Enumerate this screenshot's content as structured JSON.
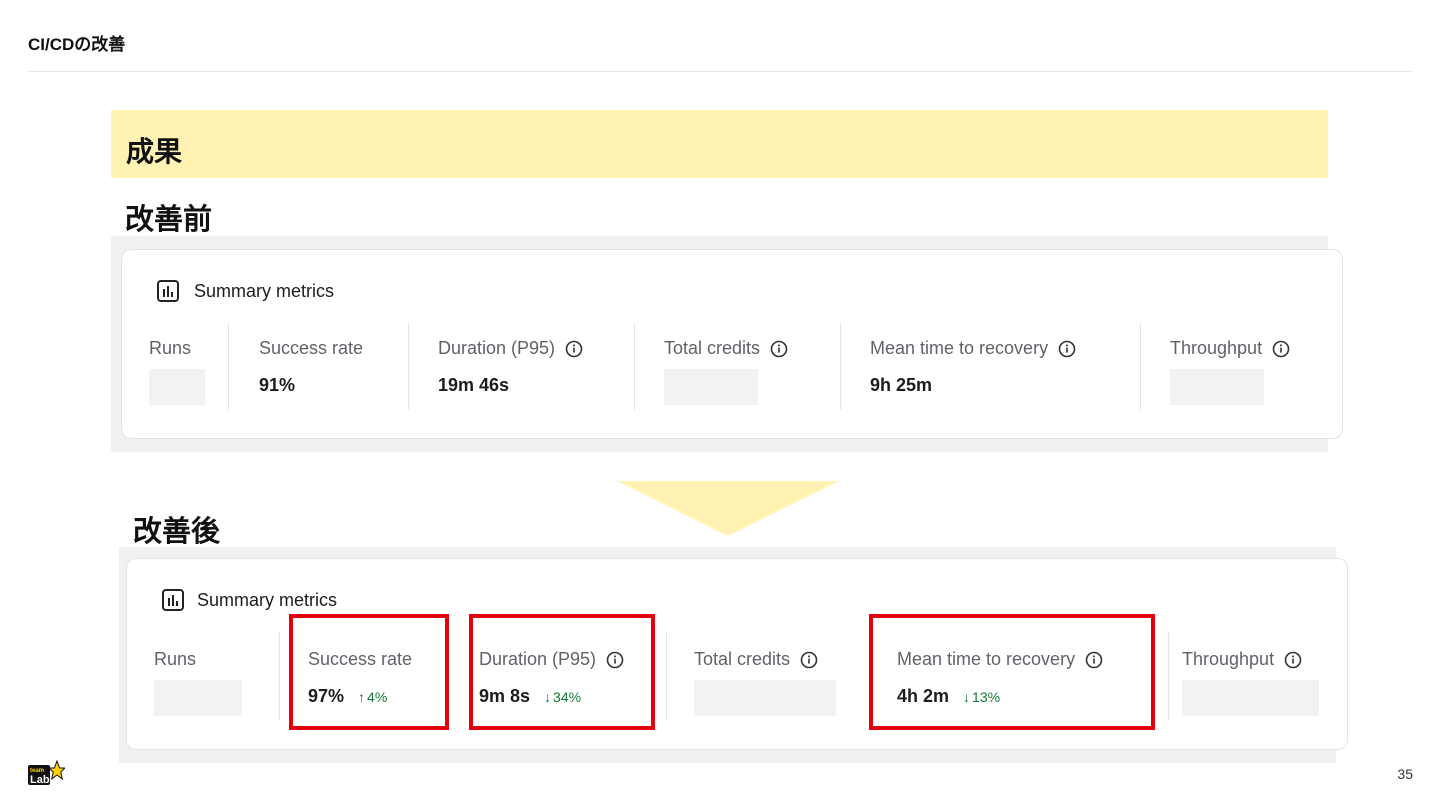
{
  "slide": {
    "title": "CI/CDの改善",
    "page_number": "35"
  },
  "banner": {
    "label": "成果"
  },
  "before": {
    "label": "改善前",
    "card_title": "Summary metrics",
    "metrics": {
      "runs": {
        "label": "Runs",
        "value": ""
      },
      "success_rate": {
        "label": "Success rate",
        "value": "91%"
      },
      "duration": {
        "label": "Duration (P95)",
        "value": "19m 46s"
      },
      "total_credits": {
        "label": "Total credits",
        "value": ""
      },
      "mttr": {
        "label": "Mean time to recovery",
        "value": "9h 25m"
      },
      "throughput": {
        "label": "Throughput",
        "value": ""
      }
    }
  },
  "after": {
    "label": "改善後",
    "card_title": "Summary metrics",
    "metrics": {
      "runs": {
        "label": "Runs",
        "value": ""
      },
      "success_rate": {
        "label": "Success rate",
        "value": "97%",
        "delta": "4%",
        "delta_direction": "up"
      },
      "duration": {
        "label": "Duration (P95)",
        "value": "9m 8s",
        "delta": "34%",
        "delta_direction": "down"
      },
      "total_credits": {
        "label": "Total credits",
        "value": ""
      },
      "mttr": {
        "label": "Mean time to recovery",
        "value": "4h 2m",
        "delta": "13%",
        "delta_direction": "down"
      },
      "throughput": {
        "label": "Throughput",
        "value": ""
      }
    }
  },
  "colors": {
    "banner": "#fff2b3",
    "highlight": "#e3000b",
    "delta_positive": "#127a2e",
    "panel_bg": "#f1f1f1"
  },
  "icons": {
    "card_icon": "bar-chart-icon",
    "info_icon": "info-icon",
    "up_arrow": "arrow-up-icon",
    "down_arrow": "arrow-down-icon",
    "logo": "team-lab-logo"
  }
}
